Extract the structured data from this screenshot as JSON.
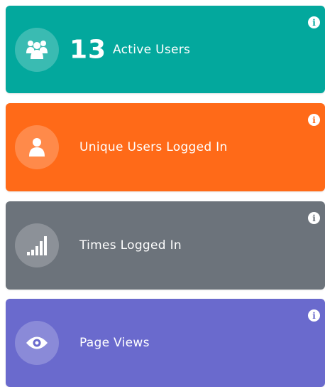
{
  "colors": {
    "active_users": "#03a89d",
    "unique_users": "#ff6a18",
    "times_logged_in": "#6c737b",
    "page_views": "#6a6acd"
  },
  "cards": [
    {
      "count": "13",
      "label": "Active Users",
      "icon": "users-group-icon",
      "info_glyph": "i"
    },
    {
      "label": "Unique Users Logged In",
      "icon": "user-icon",
      "info_glyph": "i"
    },
    {
      "label": "Times Logged In",
      "icon": "signal-bars-icon",
      "info_glyph": "i"
    },
    {
      "label": "Page Views",
      "icon": "eye-icon",
      "info_glyph": "i"
    }
  ]
}
